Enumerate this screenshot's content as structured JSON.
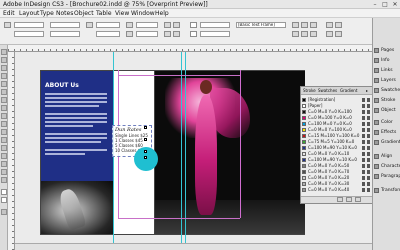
{
  "window": {
    "title": "Adobe InDesign CS3 - [Brochure02.indd @ 75% [Overprint Preview]]"
  },
  "menu": [
    "Edit",
    "Layout",
    "Type",
    "Notes",
    "Object",
    "Table",
    "View",
    "Window",
    "Help"
  ],
  "control": {
    "style_field": "[Basic Text Frame]"
  },
  "document": {
    "about_title": "ABOUT Us",
    "frame_heading": "Dun Rates",
    "frame_rows": [
      "Single Lines  $25",
      "1 Classes  $45",
      "5 Classes  $60",
      "10 Classes  $95"
    ]
  },
  "swatches": {
    "tabs": [
      "Stroke",
      "Swatches",
      "Gradient"
    ],
    "items": [
      {
        "name": "[Registration]",
        "color": "#000000"
      },
      {
        "name": "[Paper]",
        "color": "#ffffff"
      },
      {
        "name": "C=0 M=0 Y=0 K=100",
        "color": "#111111"
      },
      {
        "name": "C=0 M=100 Y=0 K=0",
        "color": "#e0007a"
      },
      {
        "name": "C=100 M=0 Y=0 K=0",
        "color": "#00a0e0"
      },
      {
        "name": "C=0 M=0 Y=100 K=0",
        "color": "#f5e600"
      },
      {
        "name": "C=15 M=100 Y=100 K=0",
        "color": "#c4161c"
      },
      {
        "name": "C=75 M=5 Y=100 K=0",
        "color": "#3aa935"
      },
      {
        "name": "C=100 M=90 Y=10 K=0",
        "color": "#22358f"
      },
      {
        "name": "C=0 M=0 Y=0 K=10",
        "color": "#e6e6e6"
      },
      {
        "name": "C=100 M=90 Y=10 K=0",
        "color": "#20308a"
      },
      {
        "name": "C=0 M=0 Y=0 K=50",
        "color": "#808080"
      },
      {
        "name": "C=0 M=0 Y=0 K=70",
        "color": "#4d4d4d"
      },
      {
        "name": "C=0 M=0 Y=0 K=20",
        "color": "#cccccc"
      },
      {
        "name": "C=0 M=0 Y=0 K=30",
        "color": "#b3b3b3"
      },
      {
        "name": "C=0 M=0 Y=0 K=40",
        "color": "#999999"
      }
    ]
  },
  "dock": [
    "Pages",
    "Info",
    "Links",
    "Layers",
    "Swatches",
    "Stroke",
    "Object",
    "Color",
    "Effects",
    "Gradient",
    "Align",
    "Character",
    "Paragraph",
    "Transform"
  ]
}
